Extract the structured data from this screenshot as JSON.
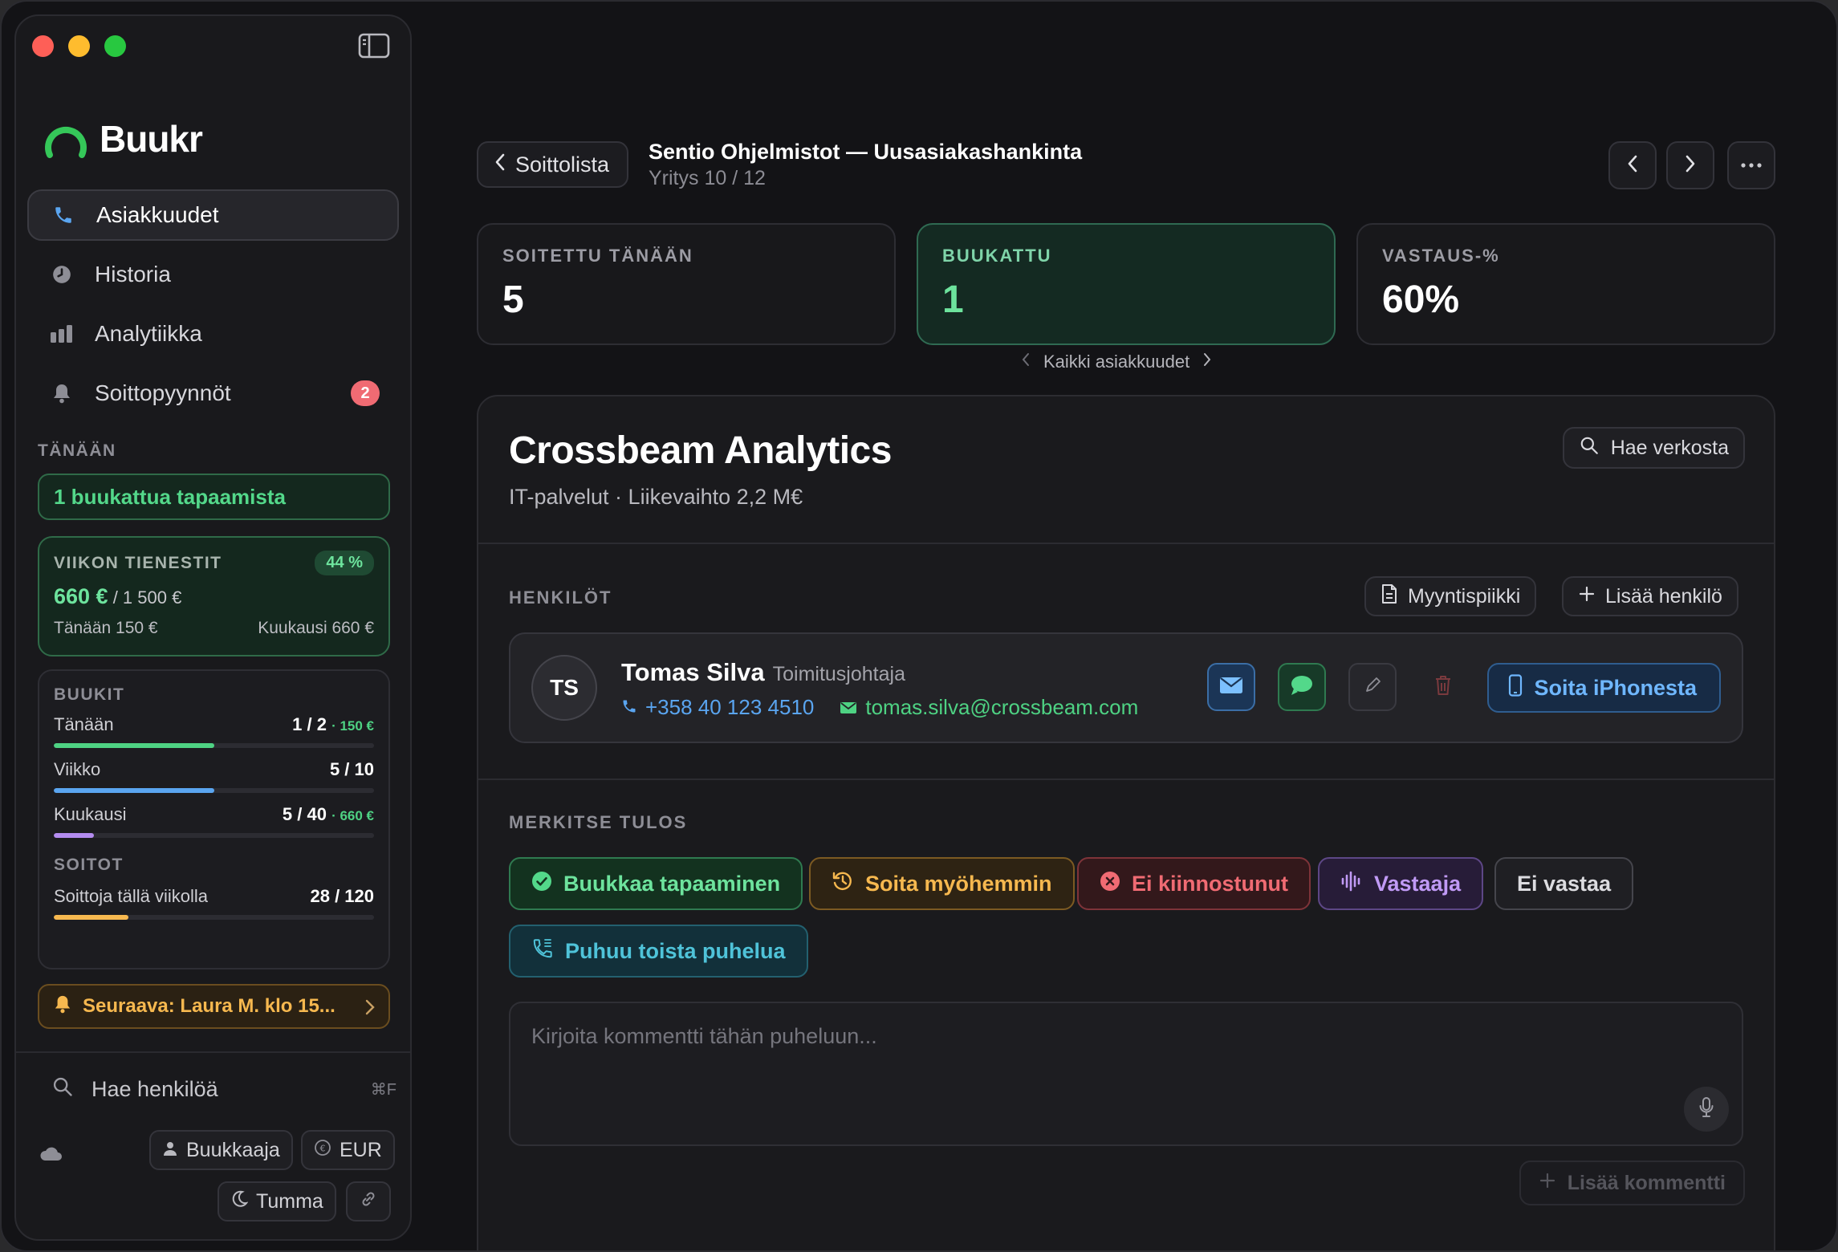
{
  "brand": {
    "name": "Buukr",
    "accent": "#35c759"
  },
  "sidebar": {
    "nav": [
      {
        "label": "Asiakkuudet",
        "icon": "phone-icon",
        "active": true
      },
      {
        "label": "Historia",
        "icon": "clock-icon"
      },
      {
        "label": "Analytiikka",
        "icon": "bar-chart-icon"
      },
      {
        "label": "Soittopyynnöt",
        "icon": "bell-icon",
        "badge": "2"
      }
    ],
    "today_label": "TÄNÄÄN",
    "booked_today": "1 buukattua tapaamista",
    "earnings": {
      "title": "VIIKON TIENESTIT",
      "percent": "44 %",
      "amount": "660 €",
      "target": "/ 1 500 €",
      "today": "Tänään 150 €",
      "month": "Kuukausi 660 €"
    },
    "bookings": {
      "title": "BUUKIT",
      "rows": [
        {
          "label": "Tänään",
          "value": "1 / 2",
          "extra": "· 150 €",
          "progress": 0.5,
          "color": "#4ed283"
        },
        {
          "label": "Viikko",
          "value": "5 / 10",
          "extra": "",
          "progress": 0.5,
          "color": "#5aa5f0"
        },
        {
          "label": "Kuukausi",
          "value": "5 / 40",
          "extra": "· 660 €",
          "progress": 0.125,
          "color": "#b48cf0"
        }
      ]
    },
    "calls": {
      "title": "SOITOT",
      "label": "Soittoja tällä viikolla",
      "value": "28 / 120",
      "progress": 0.233,
      "color": "#f6b84f"
    },
    "next": "Seuraava: Laura M. klo 15...",
    "search": {
      "placeholder": "Hae henkilöä",
      "shortcut": "⌘F"
    },
    "chips": {
      "role": "Buukkaaja",
      "currency": "EUR",
      "theme": "Tumma"
    }
  },
  "header": {
    "back_label": "Soittolista",
    "title": "Sentio Ohjelmistot — Uusasiakashankinta",
    "subtitle": "Yritys 10 / 12"
  },
  "stats": [
    {
      "label": "SOITETTU TÄNÄÄN",
      "value": "5"
    },
    {
      "label": "BUUKATTU",
      "value": "1"
    },
    {
      "label": "VASTAUS-%",
      "value": "60%"
    }
  ],
  "pager_label": "Kaikki asiakkuudet",
  "company": {
    "name": "Crossbeam Analytics",
    "meta": "IT-palvelut · Liikevaihto 2,2 M€",
    "web_search": "Hae verkosta"
  },
  "persons": {
    "title": "HENKILÖT",
    "pitch_label": "Myyntispiikki",
    "add_label": "Lisää henkilö",
    "list": [
      {
        "initials": "TS",
        "name": "Tomas Silva",
        "role": "Toimitusjohtaja",
        "phone": "+358 40 123 4510",
        "email": "tomas.silva@crossbeam.com"
      }
    ],
    "call_label": "Soita iPhonesta"
  },
  "outcome": {
    "title": "MERKITSE TULOS",
    "options": [
      {
        "label": "Buukkaa tapaaminen",
        "color": "#53d88a"
      },
      {
        "label": "Soita myöhemmin",
        "color": "#f6b84f"
      },
      {
        "label": "Ei kiinnostunut",
        "color": "#f06b73"
      },
      {
        "label": "Vastaaja",
        "color": "#b48cf0"
      },
      {
        "label": "Ei vastaa",
        "color": "#d2d2d7"
      },
      {
        "label": "Puhuu toista puhelua",
        "color": "#4fc3d9"
      }
    ]
  },
  "comment": {
    "placeholder": "Kirjoita kommentti tähän puheluun...",
    "add_label": "Lisää kommentti"
  }
}
